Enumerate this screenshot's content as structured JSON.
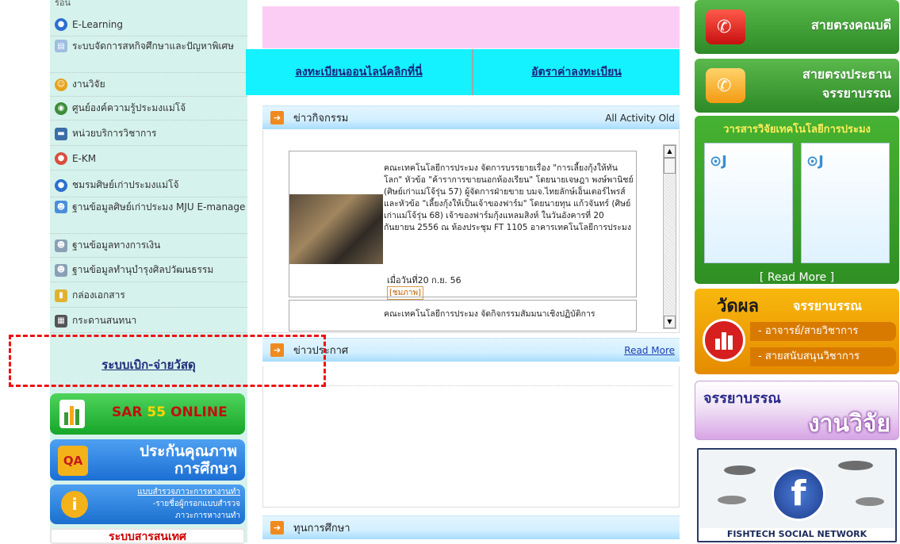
{
  "sidebar": {
    "partial_top": "ร้อน",
    "items": [
      {
        "label": "E-Learning",
        "icon": "globe-icon",
        "color": "#2b6fd0"
      },
      {
        "label": "ระบบจัดการสหกิจศึกษาและปัญหาพิเศษ",
        "icon": "document-icon",
        "color": "#9fbde0"
      },
      {
        "label": "งานวิจัย",
        "icon": "face-icon",
        "color": "#e5a21b"
      },
      {
        "label": "ศูนย์องค์ความรู้ประมงแม่โจ้",
        "icon": "earth-icon",
        "color": "#3d8c3a"
      },
      {
        "label": "หน่วยบริการวิชาการ",
        "icon": "book-icon",
        "color": "#3b6ea8"
      },
      {
        "label": "E-KM",
        "icon": "user-icon",
        "color": "#d94d3e"
      },
      {
        "label": "ชมรมศิษย์เก่าประมงแม่โจ้",
        "icon": "globe-icon",
        "color": "#2b6fd0"
      },
      {
        "label": "ฐานข้อมูลศิษย์เก่าประมง MJU E-manage",
        "icon": "people-icon",
        "color": "#4a8fd9"
      },
      {
        "label": "ฐานข้อมูลทางการเงิน",
        "icon": "people-icon",
        "color": "#8aa0b6"
      },
      {
        "label": "ฐานข้อมูลทำนุบำรุงศิลปวัฒนธรรม",
        "icon": "people-icon",
        "color": "#8aa0b6"
      },
      {
        "label": "กล่องเอกสาร",
        "icon": "box-icon",
        "color": "#e2b22f"
      },
      {
        "label": "กระดานสนทนา",
        "icon": "board-icon",
        "color": "#555555"
      }
    ],
    "borrow_link": "ระบบเบิก-จ่ายวัสดุ",
    "sar": {
      "prefix": "SAR",
      "number": "55",
      "suffix": "ONLINE"
    },
    "qa": {
      "badge": "QA",
      "line1": "ประกันคุณภาพ",
      "line2": "การศึกษา"
    },
    "survey": {
      "line1": "แบบสำรวจภาวะการหางานทำ",
      "line2": "-รายชื่อผู้กรอกแบบสำรวจ",
      "line3": "ภาวะการหางานทำ"
    },
    "rights": "ระบบสารสนเทศ"
  },
  "middle": {
    "links": {
      "register": "ลงทะเบียนออนไลน์คลิกที่นี่",
      "fees": "อัตราค่าลงทะเบียน"
    },
    "activity": {
      "title": "ข่าวกิจกรรม",
      "right": "All Activity Old",
      "news": [
        {
          "text": "คณะเทคโนโลยีการประมง จัดการบรรยายเรื่อง \"การเลี้ยงกุ้งให้ทันโลก\" หัวข้อ \"ค้าราการขายนอกห้องเรียน\" โดยนายเจษฎา พงษ์พานิชย์ (ศิษย์เก่าแม่โจ้รุ่น 57) ผู้จัดการฝ่ายขาย บมจ.ไทยลักษ์เอ็นเตอร์ไพรส์ และหัวข้อ \"เลี้ยงกุ้งให้เป็นเจ้าของฟาร์ม\" โดยนายทุน แก้วจันทร์ (ศิษย์เก่าแม่โจ้รุ่น 68) เจ้าของฟาร์มกุ้งแหลมสิงห์ ในวันอังคารที่ 20 กันยายน 2556 ณ ห้องประชุม FT 1105 อาคารเทคโนโลยีการประมง",
          "date": "เมื่อวันที่20 ก.ย. 56",
          "more": "[ชมภาพ]"
        },
        {
          "text": "คณะเทคโนโลยีการประมง จัดกิจกรรมสัมมนาเชิงปฏิบัติการ"
        }
      ]
    },
    "announce": {
      "title": "ข่าวประกาศ",
      "right": "Read More"
    },
    "scholarship": {
      "title": "ทุนการศึกษา"
    }
  },
  "right": {
    "dean_line": "สายตรงคณบดี",
    "chair_line1": "สายตรงประธาน",
    "chair_line2": "จรรยาบรรณ",
    "journal_title": "วารสารวิจัยเทคโนโลยีการประมง",
    "journal_more": "[ Read More ]",
    "ethics_title1": "วัดผล",
    "ethics_title2": "จรรยาบรรณ",
    "ethics_item1": "- อาจารย์/สายวิชาการ",
    "ethics_item2": "- สายสนับสนุนวิชาการ",
    "research_line1": "จรรยาบรรณ",
    "research_line2": "งานวิจัย",
    "fb_label": "FISHTECH SOCIAL NETWORK"
  },
  "colors": {
    "cyan": "#14f1ff",
    "pink": "#fccdf4",
    "sidebar": "#d6f2ec",
    "dashed": "#e11111"
  }
}
